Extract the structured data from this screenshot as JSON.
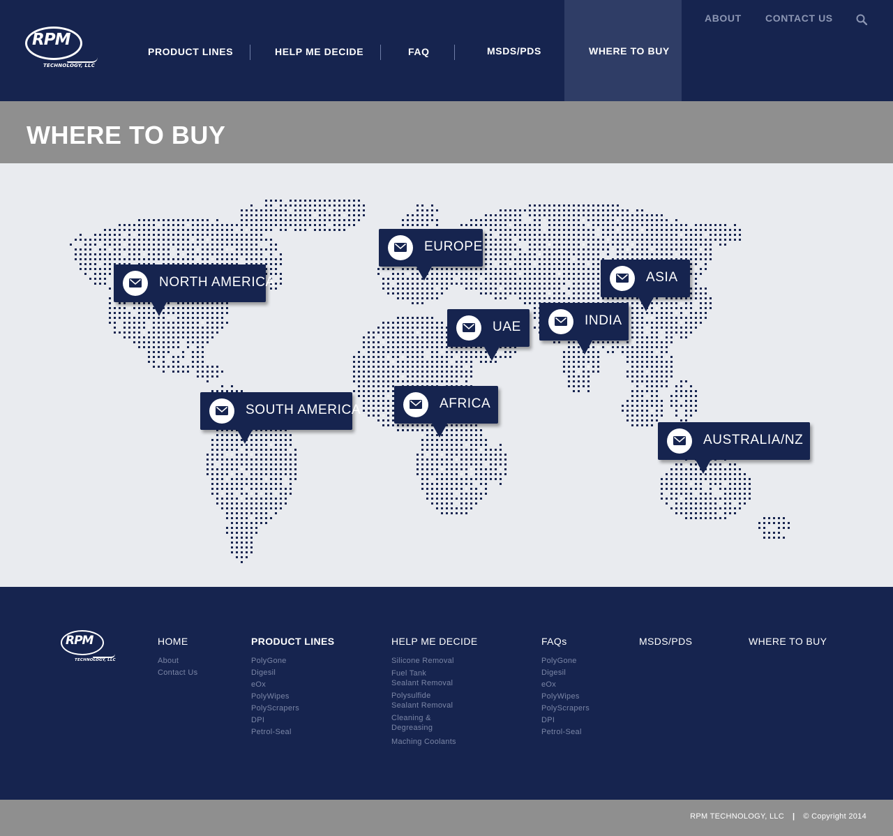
{
  "brand": {
    "logo_text": "RPM",
    "logo_subtext": "TECHNOLOGY, LLC"
  },
  "nav": {
    "product_lines": "PRODUCT LINES",
    "help_me_decide": "HELP ME DECIDE",
    "faq": "FAQ",
    "msds": "MSDS/PDS",
    "where_to_buy": "WHERE TO BUY"
  },
  "top_links": {
    "about": "ABOUT",
    "contact": "CONTACT US"
  },
  "page": {
    "title": "WHERE TO BUY"
  },
  "regions": [
    {
      "label": "NORTH AMERICA"
    },
    {
      "label": "EUROPE"
    },
    {
      "label": "UAE"
    },
    {
      "label": "INDIA"
    },
    {
      "label": "ASIA"
    },
    {
      "label": "SOUTH AMERICA"
    },
    {
      "label": "AFRICA"
    },
    {
      "label": "AUSTRALIA/NZ"
    }
  ],
  "footer": {
    "home": {
      "heading": "HOME",
      "links": [
        "About",
        "Contact Us"
      ]
    },
    "product_lines": {
      "heading": "PRODUCT LINES",
      "links": [
        "PolyGone",
        "Digesil",
        "eOx",
        "PolyWipes",
        "PolyScrapers",
        "DPI",
        "Petrol-Seal"
      ]
    },
    "help_me_decide": {
      "heading": "HELP ME DECIDE",
      "links": [
        "Silicone Removal",
        "Fuel Tank\nSealant Removal",
        "Polysulfide\nSealant Removal",
        "Cleaning &\nDegreasing",
        "Maching Coolants"
      ]
    },
    "faqs": {
      "heading": "FAQs",
      "links": [
        "PolyGone",
        "Digesil",
        "eOx",
        "PolyWipes",
        "PolyScrapers",
        "DPI",
        "Petrol-Seal"
      ]
    },
    "msds": {
      "heading": "MSDS/PDS"
    },
    "where_to_buy": {
      "heading": "WHERE TO BUY"
    }
  },
  "copyright": {
    "company": "RPM TECHNOLOGY, LLC",
    "separator": "|",
    "notice": "© Copyright 2014"
  },
  "colors": {
    "navy": "#16244f",
    "active_nav": "#2f3d66",
    "gray_band": "#8f8f8f",
    "map_bg": "#e9ebef",
    "dot": "#16244f"
  }
}
